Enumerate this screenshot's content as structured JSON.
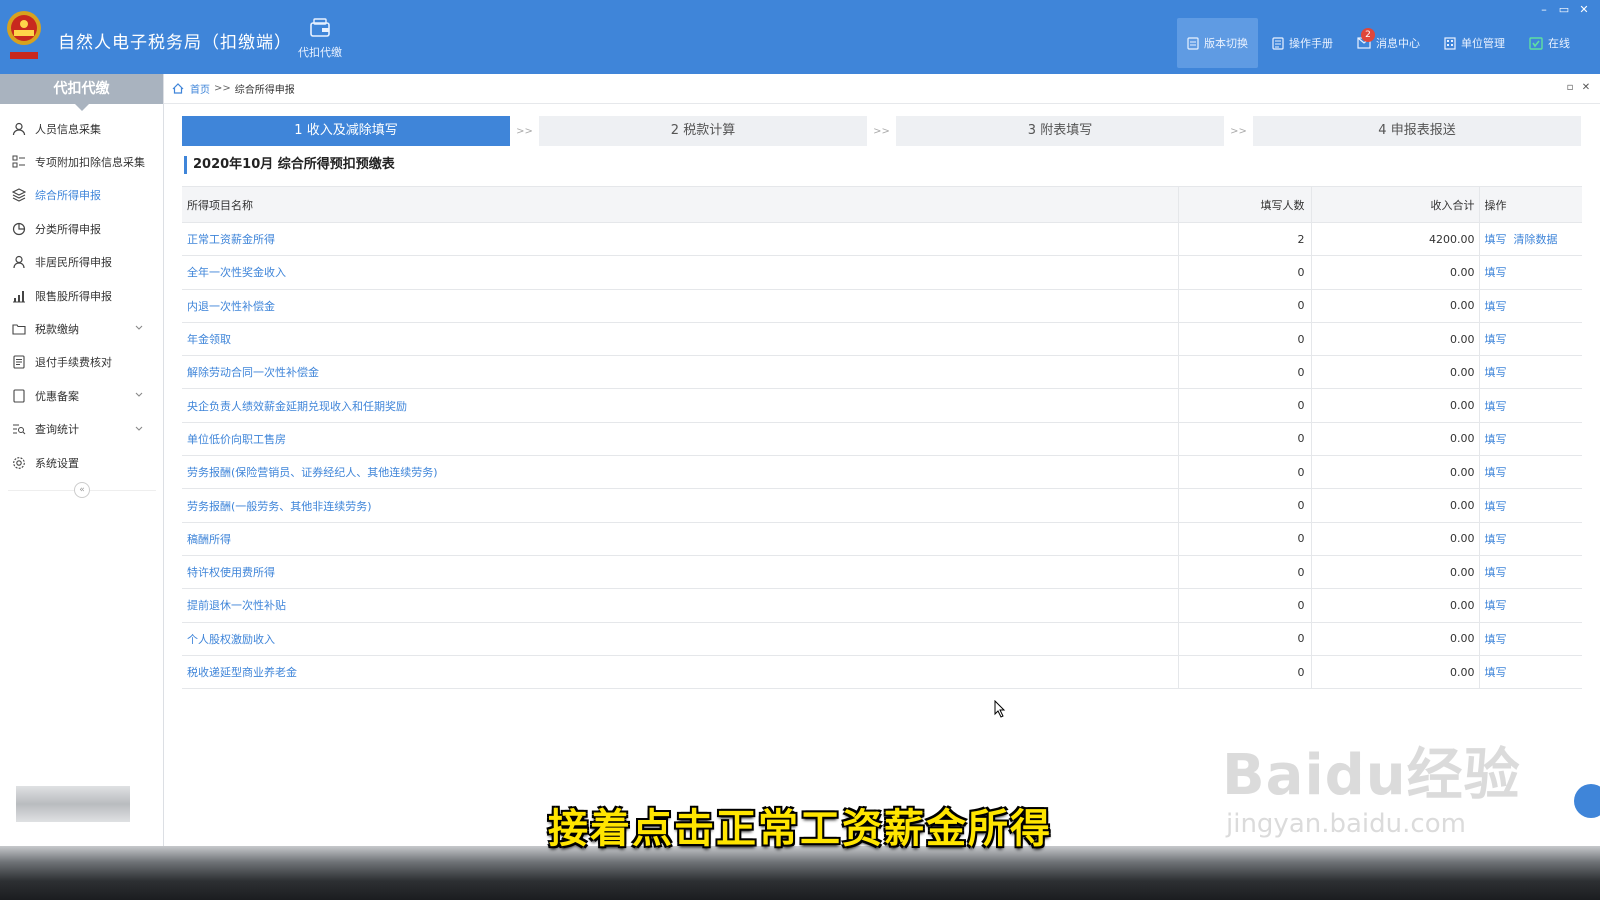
{
  "app": {
    "title": "自然人电子税务局（扣缴端）",
    "module_label": "代扣代缴",
    "actions": [
      {
        "label": "版本切换",
        "icon": "version-icon"
      },
      {
        "label": "操作手册",
        "icon": "manual-icon"
      },
      {
        "label": "消息中心",
        "icon": "mail-icon",
        "badge": "2"
      },
      {
        "label": "单位管理",
        "icon": "building-icon"
      },
      {
        "label": "在线",
        "icon": "online-check-icon"
      }
    ]
  },
  "sidebar": {
    "header": "代扣代缴",
    "items": [
      {
        "label": "人员信息采集",
        "icon": "person-icon"
      },
      {
        "label": "专项附加扣除信息采集",
        "icon": "list-icon"
      },
      {
        "label": "综合所得申报",
        "icon": "layers-icon"
      },
      {
        "label": "分类所得申报",
        "icon": "pie-icon"
      },
      {
        "label": "非居民所得申报",
        "icon": "person-outline-icon"
      },
      {
        "label": "限售股所得申报",
        "icon": "bar-chart-icon"
      },
      {
        "label": "税款缴纳",
        "icon": "folder-icon"
      },
      {
        "label": "退付手续费核对",
        "icon": "document-icon"
      },
      {
        "label": "优惠备案",
        "icon": "file-icon"
      },
      {
        "label": "查询统计",
        "icon": "search-list-icon"
      },
      {
        "label": "系统设置",
        "icon": "gear-icon"
      }
    ]
  },
  "breadcrumb": {
    "home": "首页",
    "separator": ">>",
    "current": "综合所得申报"
  },
  "steps": [
    {
      "label": "1 收入及减除填写"
    },
    {
      "label": "2 税款计算"
    },
    {
      "label": "3 附表填写"
    },
    {
      "label": "4 申报表报送"
    }
  ],
  "step_arrow": ">>",
  "section_title": "2020年10月  综合所得预扣预缴表",
  "table": {
    "headers": {
      "name": "所得项目名称",
      "count": "填写人数",
      "income": "收入合计",
      "op": "操作"
    },
    "rows": [
      {
        "name": "正常工资薪金所得",
        "count": "2",
        "income": "4200.00",
        "ops": [
          "填写",
          "清除数据"
        ]
      },
      {
        "name": "全年一次性奖金收入",
        "count": "0",
        "income": "0.00",
        "ops": [
          "填写"
        ]
      },
      {
        "name": "内退一次性补偿金",
        "count": "0",
        "income": "0.00",
        "ops": [
          "填写"
        ]
      },
      {
        "name": "年金领取",
        "count": "0",
        "income": "0.00",
        "ops": [
          "填写"
        ]
      },
      {
        "name": "解除劳动合同一次性补偿金",
        "count": "0",
        "income": "0.00",
        "ops": [
          "填写"
        ]
      },
      {
        "name": "央企负责人绩效薪金延期兑现收入和任期奖励",
        "count": "0",
        "income": "0.00",
        "ops": [
          "填写"
        ]
      },
      {
        "name": "单位低价向职工售房",
        "count": "0",
        "income": "0.00",
        "ops": [
          "填写"
        ]
      },
      {
        "name": "劳务报酬(保险营销员、证券经纪人、其他连续劳务)",
        "count": "0",
        "income": "0.00",
        "ops": [
          "填写"
        ]
      },
      {
        "name": "劳务报酬(一般劳务、其他非连续劳务)",
        "count": "0",
        "income": "0.00",
        "ops": [
          "填写"
        ]
      },
      {
        "name": "稿酬所得",
        "count": "0",
        "income": "0.00",
        "ops": [
          "填写"
        ]
      },
      {
        "name": "特许权使用费所得",
        "count": "0",
        "income": "0.00",
        "ops": [
          "填写"
        ]
      },
      {
        "name": "提前退休一次性补贴",
        "count": "0",
        "income": "0.00",
        "ops": [
          "填写"
        ]
      },
      {
        "name": "个人股权激励收入",
        "count": "0",
        "income": "0.00",
        "ops": [
          "填写"
        ]
      },
      {
        "name": "税收递延型商业养老金",
        "count": "0",
        "income": "0.00",
        "ops": [
          "填写"
        ]
      }
    ]
  },
  "overlay": {
    "subtitle": "接着点击正常工资薪金所得",
    "watermark_big": "Baidu经验",
    "watermark_small": "jingyan.baidu.com"
  },
  "colors": {
    "primary": "#3f85d9",
    "badge": "#e0473b",
    "subtitle": "#ffe500"
  }
}
